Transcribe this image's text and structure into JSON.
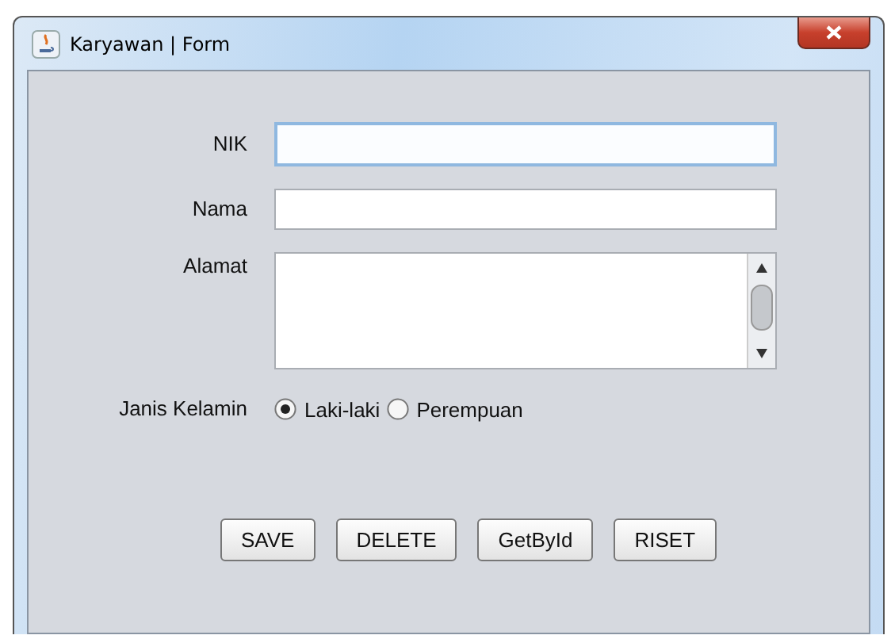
{
  "window": {
    "title": "Karyawan | Form"
  },
  "fields": [
    {
      "label": "NIK",
      "kind": "text",
      "focused": true
    },
    {
      "label": "Nama",
      "kind": "text",
      "focused": false
    },
    {
      "label": "Alamat",
      "kind": "textarea"
    }
  ],
  "gender": {
    "label": "Janis Kelamin",
    "options": [
      {
        "label": "Laki-laki",
        "selected": true
      },
      {
        "label": "Perempuan",
        "selected": false
      }
    ]
  },
  "buttons": [
    "SAVE",
    "DELETE",
    "GetById",
    "RISET"
  ]
}
